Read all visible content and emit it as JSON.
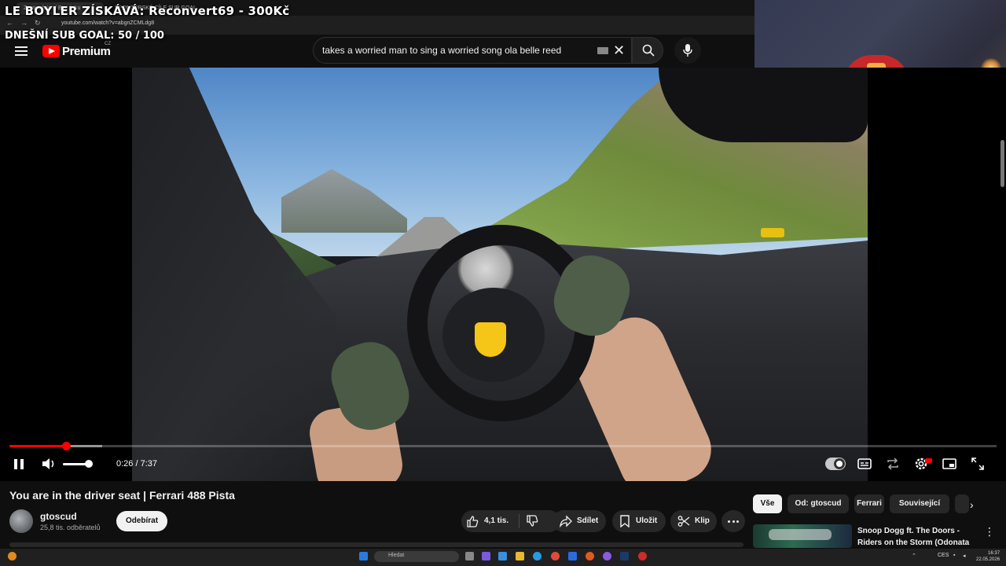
{
  "browser": {
    "tabs": [
      "Zpravodajství Bez tisku",
      "SPONZORSKÉ CÍLE SUB GOAL"
    ],
    "url": "youtube.com/watch?v=abgnZCMLdg8"
  },
  "overlay": {
    "title": "LE BOYLER ZÍSKÁVÁ: Reconvert69 - 300Kč",
    "goal": "DNEŠNÍ SUB GOAL:  50 / 100"
  },
  "header": {
    "logo_text": "Premium",
    "region": "CZ",
    "search_value": "takes a worried man to sing a worried song ola belle reed",
    "icons": [
      "menu-icon",
      "youtube-logo",
      "keyboard-icon",
      "clear-icon",
      "search-icon",
      "mic-icon"
    ]
  },
  "player": {
    "time": "0:26 / 7:37",
    "progress_fraction": 0.057,
    "buffer_fraction": 0.094,
    "volume_fraction": 1.0,
    "icons": [
      "pause-icon",
      "volume-icon",
      "autoplay-toggle",
      "subtitles-icon",
      "loop-icon",
      "settings-icon",
      "miniplayer-icon",
      "fullscreen-icon"
    ],
    "colors": {
      "progress": "#ff0000",
      "hd_badge": "#ff0000"
    }
  },
  "video": {
    "title": "You are in the driver seat | Ferrari 488 Pista",
    "channel": "gtoscud",
    "subscribers": "25,8 tis. odběratelů",
    "subscribe_label": "Odebírat",
    "likes": "4,1 tis.",
    "share_label": "Sdílet",
    "save_label": "Uložit",
    "clip_label": "Klip"
  },
  "sidebar": {
    "chips": [
      "Vše",
      "Od: gtoscud",
      "Ferrari",
      "Související"
    ],
    "rec_title": "Snoop Dogg ft. The Doors - Riders on the Storm (Odonata ..."
  },
  "taskbar": {
    "search_placeholder": "Hledat",
    "lang": "CES",
    "time": "16:37",
    "date": "22.05.2026"
  }
}
